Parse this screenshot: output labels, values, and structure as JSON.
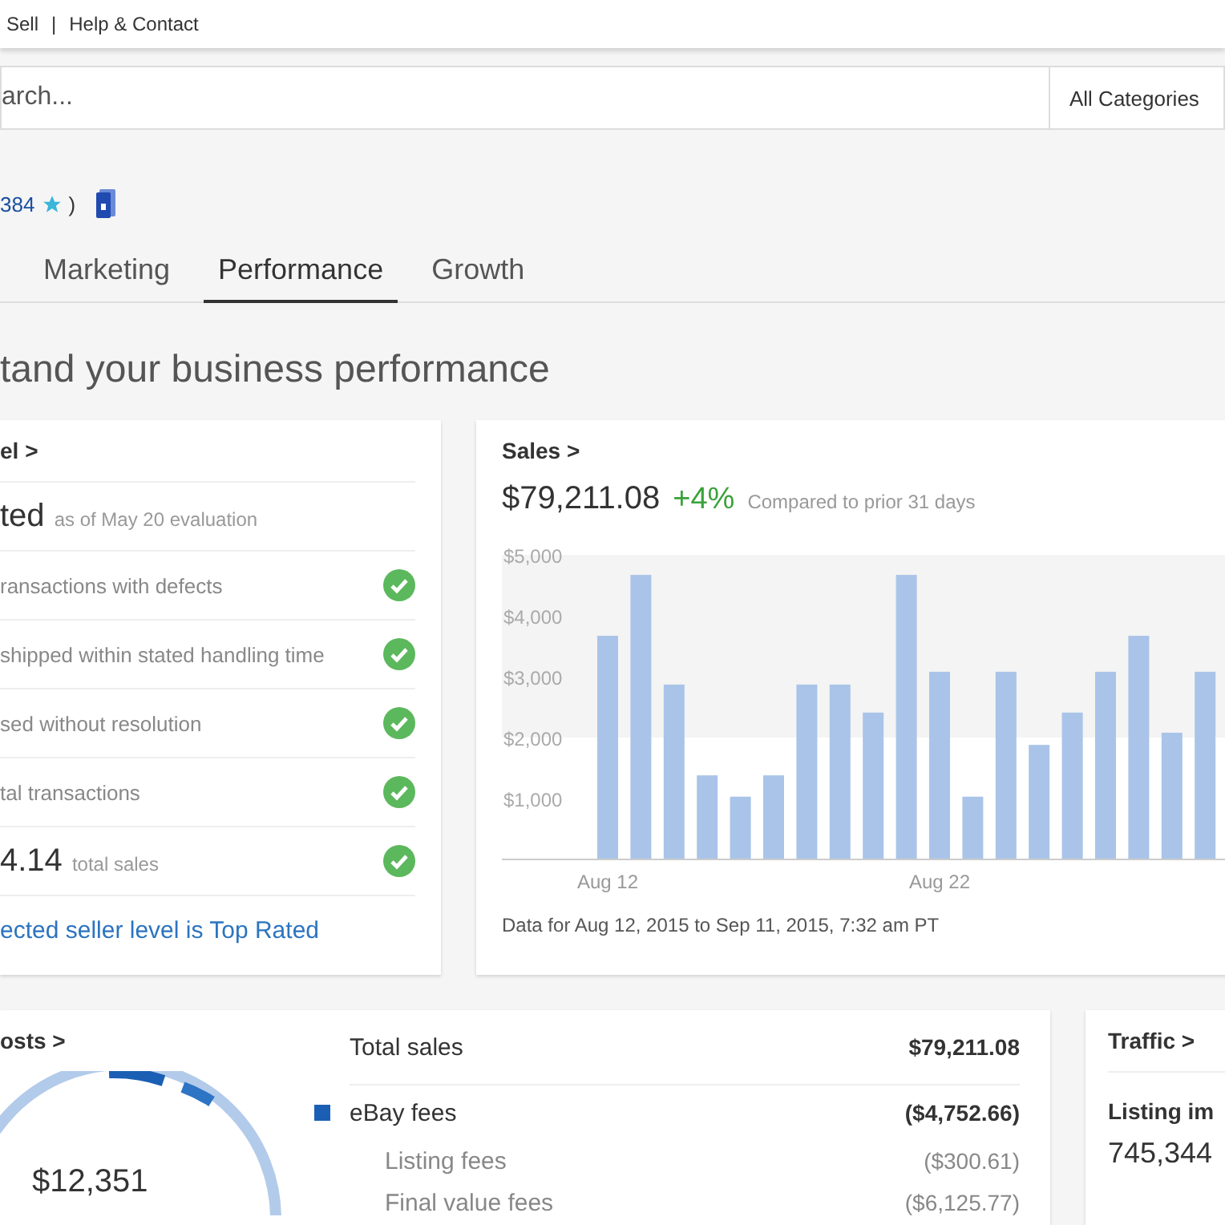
{
  "top_nav": {
    "links": [
      "Sell",
      "Help & Contact"
    ],
    "separator": "|"
  },
  "search": {
    "placeholder": "arch...",
    "category": "All Categories"
  },
  "seller": {
    "feedback": "384",
    "suffix": ")"
  },
  "tabs": [
    {
      "label": "Marketing",
      "selected": false
    },
    {
      "label": "Performance",
      "selected": true
    },
    {
      "label": "Growth",
      "selected": false
    }
  ],
  "heading": "tand your business performance",
  "seller_level": {
    "title": "el >",
    "status": "ted",
    "status_note": "as of May 20 evaluation",
    "criteria": [
      {
        "kind": "note",
        "label": "ransactions with defects",
        "passed": true
      },
      {
        "kind": "note",
        "label": "shipped within stated handling time",
        "passed": true
      },
      {
        "kind": "note",
        "label": "sed without resolution",
        "passed": true
      },
      {
        "kind": "note",
        "label": "tal transactions",
        "passed": true
      },
      {
        "kind": "figure",
        "value": "4.14",
        "label": "total sales",
        "passed": true
      }
    ],
    "link": "ected seller level is Top Rated"
  },
  "sales": {
    "title": "Sales >",
    "total": "$79,211.08",
    "change": "+4%",
    "comparison": "Compared to prior 31 days",
    "chart_data": {
      "type": "bar",
      "categories": [
        "Aug 12",
        null,
        null,
        null,
        null,
        null,
        null,
        null,
        null,
        null,
        "Aug 22",
        null,
        null,
        null,
        null,
        null,
        null,
        null,
        null
      ],
      "values": [
        3670,
        4670,
        2870,
        1380,
        1030,
        1380,
        2870,
        2870,
        2410,
        4670,
        3080,
        1030,
        3080,
        1880,
        2410,
        3080,
        3670,
        2080,
        3080
      ],
      "ylim": [
        0,
        5000
      ],
      "yticks": [
        {
          "value": 1000,
          "label": "$1,000"
        },
        {
          "value": 2000,
          "label": "$2,000"
        },
        {
          "value": 3000,
          "label": "$3,000"
        },
        {
          "value": 4000,
          "label": "$4,000"
        },
        {
          "value": 5000,
          "label": "$5,000"
        }
      ]
    },
    "footnote": "Data for Aug 12, 2015 to Sep 11, 2015, 7:32 am PT"
  },
  "costs": {
    "title": "osts >",
    "donut_value": "$12,351",
    "rows": [
      {
        "kind": "total",
        "label": "Total sales",
        "amount": "$79,211.08"
      },
      {
        "kind": "group",
        "label": "eBay fees",
        "amount": "($4,752.66)"
      },
      {
        "kind": "sub",
        "label": "Listing fees",
        "amount": "($300.61)"
      },
      {
        "kind": "sub",
        "label": "Final value fees",
        "amount": "($6,125.77)"
      }
    ]
  },
  "traffic": {
    "title": "Traffic >",
    "metric_label": "Listing im",
    "metric_value": "745,344"
  }
}
